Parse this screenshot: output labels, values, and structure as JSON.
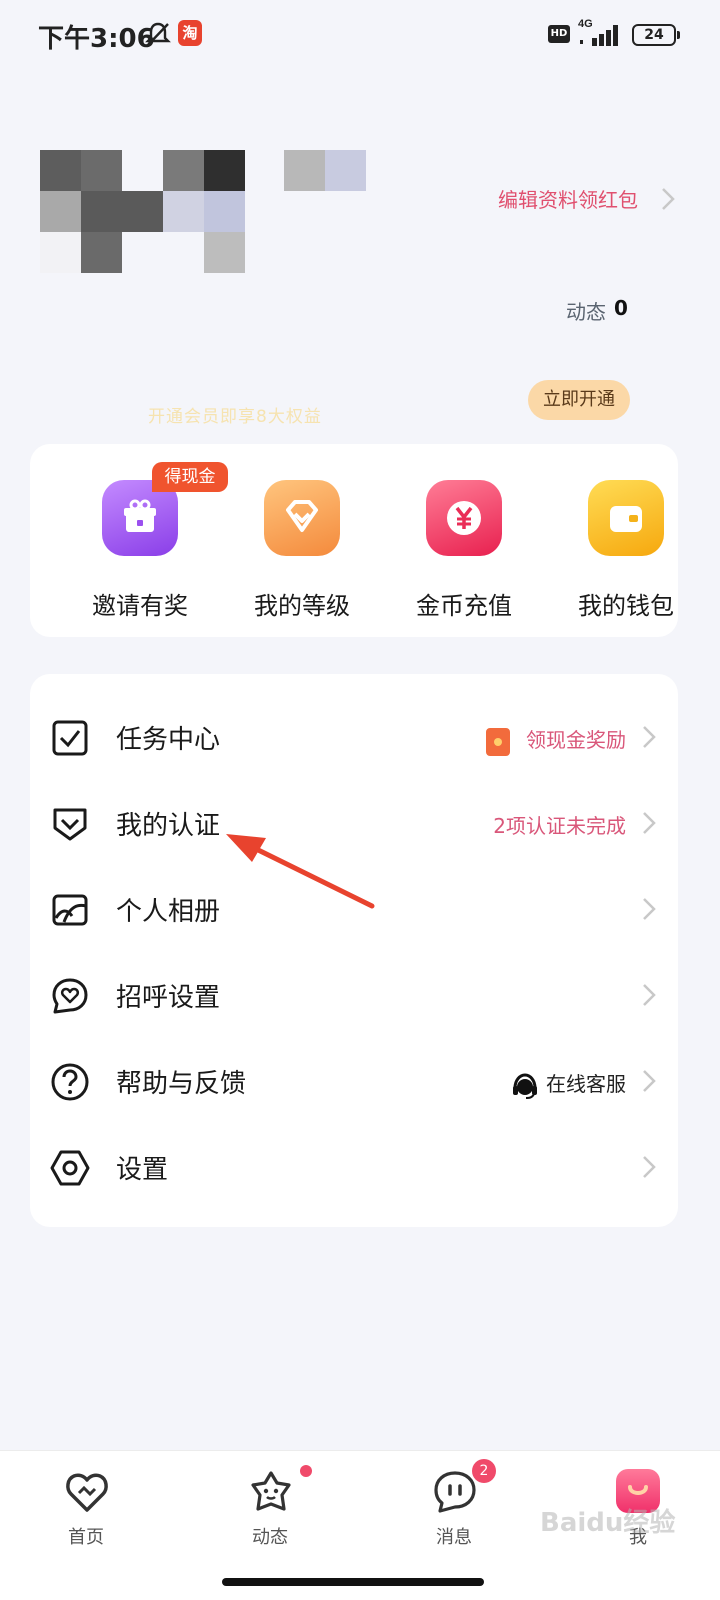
{
  "status_bar": {
    "time": "下午3:06",
    "network": "4G",
    "hd": "HD",
    "battery": "24",
    "app_icon_text": "淘"
  },
  "profile": {
    "edit_link": "编辑资料领红包",
    "moments_label": "动态",
    "moments_count": "0"
  },
  "vip": {
    "text": "开通会员即享8大权益",
    "button": "立即开通"
  },
  "quick_actions": [
    {
      "label": "邀请有奖",
      "icon": "gift-icon",
      "badge": "得现金",
      "color": "#a35cf0"
    },
    {
      "label": "我的等级",
      "icon": "diamond-icon",
      "color": "#f7a052"
    },
    {
      "label": "金币充值",
      "icon": "yen-coin-icon",
      "color": "#f2416e"
    },
    {
      "label": "我的钱包",
      "icon": "wallet-icon",
      "color": "#f8c22a"
    }
  ],
  "menu": [
    {
      "label": "任务中心",
      "icon": "task-check-icon",
      "right": "领现金奖励"
    },
    {
      "label": "我的认证",
      "icon": "shield-check-icon",
      "right": "2项认证未完成"
    },
    {
      "label": "个人相册",
      "icon": "album-icon",
      "right": ""
    },
    {
      "label": "招呼设置",
      "icon": "heart-chat-icon",
      "right": ""
    },
    {
      "label": "帮助与反馈",
      "icon": "help-icon",
      "right": "在线客服"
    },
    {
      "label": "设置",
      "icon": "settings-hex-icon",
      "right": ""
    }
  ],
  "bottom_nav": [
    {
      "label": "首页",
      "icon": "home-heart-icon"
    },
    {
      "label": "动态",
      "icon": "star-face-icon"
    },
    {
      "label": "消息",
      "icon": "message-icon",
      "badge": "2"
    },
    {
      "label": "我",
      "icon": "me-icon"
    }
  ],
  "colors": {
    "accent_pink": "#e0506f",
    "badge_red": "#f04a6a",
    "background": "#f4f5fa"
  }
}
